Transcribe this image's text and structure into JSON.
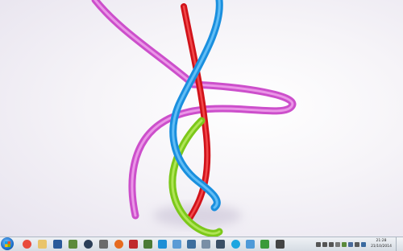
{
  "wallpaper": {
    "description_name": "colorful-ribbons-wallpaper",
    "colors": {
      "magenta": "#d96ad6",
      "red": "#e21a1a",
      "blue": "#2aa3ee",
      "green": "#8fd81e"
    }
  },
  "taskbar": {
    "start_icon": "windows-orb-icon",
    "pinned": [
      {
        "name": "chrome-icon",
        "color": "#e94b3c"
      },
      {
        "name": "folder-icon",
        "color": "#e9c46a"
      },
      {
        "name": "app-icon-1",
        "color": "#2a5a9a"
      },
      {
        "name": "app-icon-2",
        "color": "#5c8a3a"
      },
      {
        "name": "steam-icon",
        "color": "#2b3e57"
      },
      {
        "name": "app-icon-3",
        "color": "#6b6b6b"
      },
      {
        "name": "firefox-icon",
        "color": "#e66b1f"
      },
      {
        "name": "filezilla-icon",
        "color": "#c0282c"
      },
      {
        "name": "app-icon-4",
        "color": "#4b7a35"
      },
      {
        "name": "app-icon-5",
        "color": "#1e8fd6"
      },
      {
        "name": "app-icon-6",
        "color": "#5b9bd5"
      },
      {
        "name": "app-icon-7",
        "color": "#3c6e9e"
      },
      {
        "name": "app-icon-8",
        "color": "#7a8fa6"
      },
      {
        "name": "app-icon-9",
        "color": "#3a4f66"
      },
      {
        "name": "skype-icon",
        "color": "#1ea6e0"
      },
      {
        "name": "app-icon-10",
        "color": "#4f9ad8"
      },
      {
        "name": "app-icon-11",
        "color": "#3a9a3a"
      },
      {
        "name": "app-icon-12",
        "color": "#444444"
      },
      {
        "name": "app-icon-13",
        "color": "#3e8e3e"
      }
    ],
    "tray_icons": [
      {
        "name": "media-prev-icon",
        "color": "#555"
      },
      {
        "name": "media-play-icon",
        "color": "#555"
      },
      {
        "name": "media-next-icon",
        "color": "#555"
      },
      {
        "name": "tray-icon-1",
        "color": "#777"
      },
      {
        "name": "tray-icon-2",
        "color": "#5a8a3a"
      },
      {
        "name": "network-icon",
        "color": "#4a6a9a"
      },
      {
        "name": "volume-icon",
        "color": "#5a5a5a"
      },
      {
        "name": "tray-icon-3",
        "color": "#3a6aa0"
      }
    ],
    "clock": {
      "time": "21:28",
      "date": "21/10/2014"
    }
  }
}
